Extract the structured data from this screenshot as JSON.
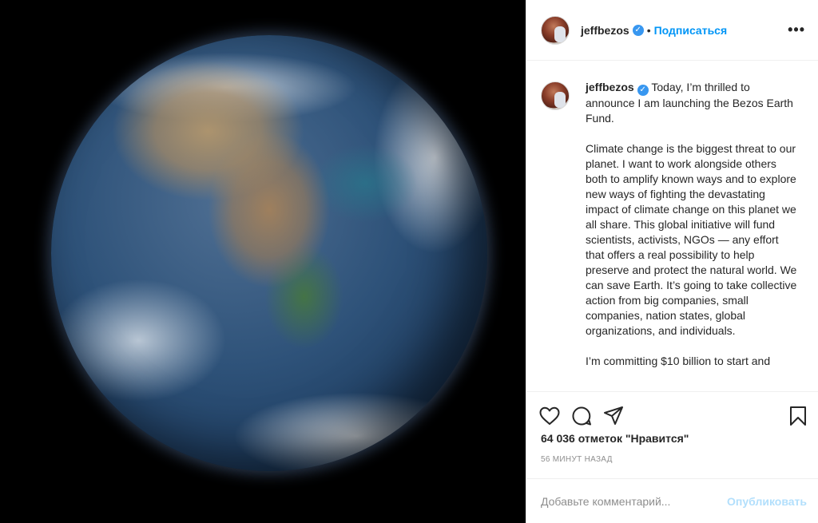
{
  "header": {
    "username": "jeffbezos",
    "dot": "•",
    "follow_label": "Подписаться",
    "more_label": "•••"
  },
  "caption": {
    "username": "jeffbezos",
    "paragraphs": [
      "Today, I’m thrilled to announce I am launching the Bezos Earth Fund.",
      "Climate change is the biggest threat to our planet. I want to work alongside others both to amplify known ways and to explore new ways of fighting the devastating impact of climate change on this planet we all share. This global initiative will fund scientists, activists, NGOs — any effort that offers a real possibility to help preserve and protect the natural world. We can save Earth. It’s going to take collective action from big companies, small companies, nation states, global organizations, and individuals.",
      "I’m committing $10 billion to start and"
    ]
  },
  "likes_text": "64 036 отметок \"Нравится\"",
  "time_text": "56 МИНУТ НАЗАД",
  "comment": {
    "placeholder": "Добавьте комментарий...",
    "publish_label": "Опубликовать"
  },
  "colors": {
    "accent": "#0095f6",
    "verified": "#3897f0",
    "publish_disabled": "#b2dffc",
    "muted": "#8e8e8e"
  },
  "icons": [
    "heart-icon",
    "comment-icon",
    "share-icon",
    "bookmark-icon",
    "verified-badge-icon",
    "more-options-icon"
  ]
}
